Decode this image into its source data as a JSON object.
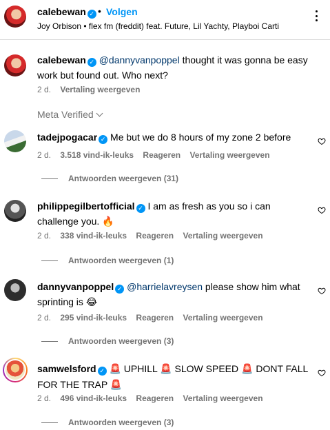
{
  "post": {
    "username": "calebewan",
    "separator": "•",
    "follow_label": "Volgen",
    "song": "Joy Orbison • flex fm (freddit) feat. Future, Lil Yachty, Playboi Carti",
    "caption_mention": "@dannyvanpoppel",
    "caption_text": " thought it was gonna be easy work but found out. Who next?",
    "caption_time": "2 d.",
    "caption_translate": "Vertaling weergeven"
  },
  "filter_label": "Meta Verified",
  "comments": [
    {
      "username": "tadejpogacar",
      "text": "Me but we do 8 hours of my zone 2 before",
      "time": "2 d.",
      "likes": "3.518 vind-ik-leuks",
      "reply": "Reageren",
      "translate": "Vertaling weergeven",
      "replies": "Antwoorden weergeven (31)"
    },
    {
      "username": "philippegilbertofficial",
      "text_line1": "I am as fresh as you so i can",
      "text_line2": "challenge you. ",
      "emoji": "🔥",
      "time": "2 d.",
      "likes": "338 vind-ik-leuks",
      "reply": "Reageren",
      "translate": "Vertaling weergeven",
      "replies": "Antwoorden weergeven (1)"
    },
    {
      "username": "dannyvanpoppel",
      "mention": "@harrielavreysen",
      "text_line1": " please show him what",
      "text_line2": "sprinting is ",
      "emoji": "😂",
      "time": "2 d.",
      "likes": "295 vind-ik-leuks",
      "reply": "Reageren",
      "translate": "Vertaling weergeven",
      "replies": "Antwoorden weergeven (3)"
    },
    {
      "username": "samwelsford",
      "siren": "🚨",
      "part1": " UPHILL ",
      "part2": " SLOW SPEED ",
      "part3": " DONT FALL",
      "part4": "FOR THE TRAP ",
      "time": "2 d.",
      "likes": "496 vind-ik-leuks",
      "reply": "Reageren",
      "translate": "Vertaling weergeven",
      "replies": "Antwoorden weergeven (3)"
    }
  ],
  "icons": {
    "verified": "verified-badge-icon",
    "more": "more-options-icon",
    "heart": "heart-outline-icon",
    "chevron": "chevron-down-icon"
  },
  "colors": {
    "accent": "#0095f6",
    "mention": "#00376b",
    "secondary_text": "#737373"
  }
}
